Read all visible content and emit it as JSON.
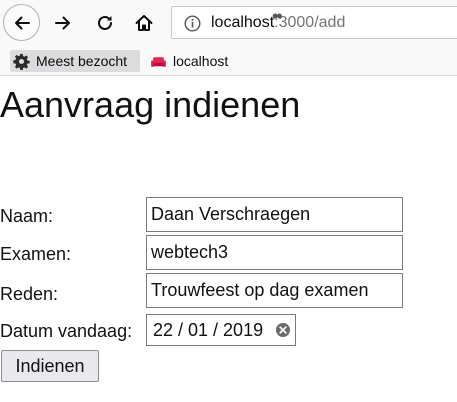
{
  "browser": {
    "url_host": "localhost",
    "url_path": ":3000/add",
    "page_actions_label": "••",
    "bookmarks": [
      {
        "label": "Meest bezocht",
        "icon": "gear-icon"
      },
      {
        "label": "localhost",
        "icon": "sofa-icon"
      }
    ]
  },
  "page": {
    "title": "Aanvraag indienen"
  },
  "form": {
    "naam_label": "Naam:",
    "naam_value": "Daan Verschraegen",
    "examen_label": "Examen:",
    "examen_value": "webtech3",
    "reden_label": "Reden:",
    "reden_value": "Trouwfeest op dag examen",
    "datum_label": "Datum vandaag:",
    "datum_value": "22 / 01 / 2019",
    "submit_label": "Indienen"
  },
  "colors": {
    "bookmark_icon_red": "#e22850",
    "toolbar_bg": "#f9f9fa"
  }
}
